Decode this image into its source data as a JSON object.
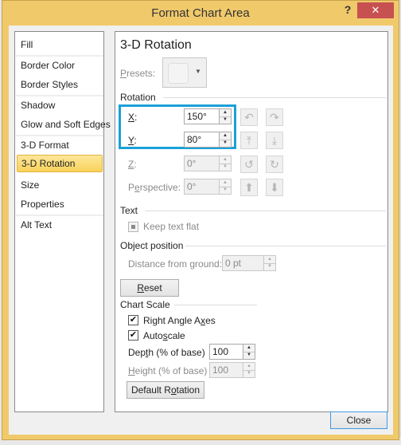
{
  "window": {
    "title": "Format Chart Area",
    "help_label": "?",
    "close_glyph": "✕",
    "accent_color": "#f0c96b",
    "close_color": "#c75050",
    "highlight_color": "#1aa0d8"
  },
  "sidebar": {
    "items": [
      {
        "label": "Fill"
      },
      {
        "label": "Border Color"
      },
      {
        "label": "Border Styles"
      },
      {
        "label": "Shadow"
      },
      {
        "label": "Glow and Soft Edges"
      },
      {
        "label": "3-D Format"
      },
      {
        "label": "3-D Rotation",
        "selected": true
      },
      {
        "label": "Size"
      },
      {
        "label": "Properties"
      },
      {
        "label": "Alt Text"
      }
    ]
  },
  "panel": {
    "heading": "3-D Rotation",
    "presets_label": "Presets:",
    "rotation": {
      "section_label": "Rotation",
      "x": {
        "label": "X:",
        "value": "150°"
      },
      "y": {
        "label": "Y:",
        "value": "80°"
      },
      "z": {
        "label": "Z:",
        "value": "0°"
      },
      "perspective": {
        "label": "Perspective:",
        "value": "0°"
      },
      "icons": [
        "rotate-left-icon",
        "rotate-right-icon",
        "rotate-up-icon",
        "rotate-down-icon",
        "rotate-counterclockwise-icon",
        "rotate-clockwise-icon",
        "narrow-perspective-icon",
        "widen-perspective-icon"
      ]
    },
    "text": {
      "section_label": "Text",
      "keep_text_flat_label": "Keep text flat",
      "keep_text_flat_checked": true
    },
    "object_position": {
      "section_label": "Object position",
      "distance_label": "Distance from ground:",
      "distance_value": "0 pt",
      "reset_label": "Reset"
    },
    "chart_scale": {
      "section_label": "Chart Scale",
      "right_angle_axes_label": "Right Angle Axes",
      "right_angle_axes_checked": true,
      "autoscale_label": "Autoscale",
      "autoscale_checked": true,
      "depth_label": "Depth (% of base)",
      "depth_value": "100",
      "height_label": "Height (% of base)",
      "height_value": "100",
      "default_rotation_label": "Default Rotation"
    }
  },
  "footer": {
    "close_label": "Close"
  }
}
